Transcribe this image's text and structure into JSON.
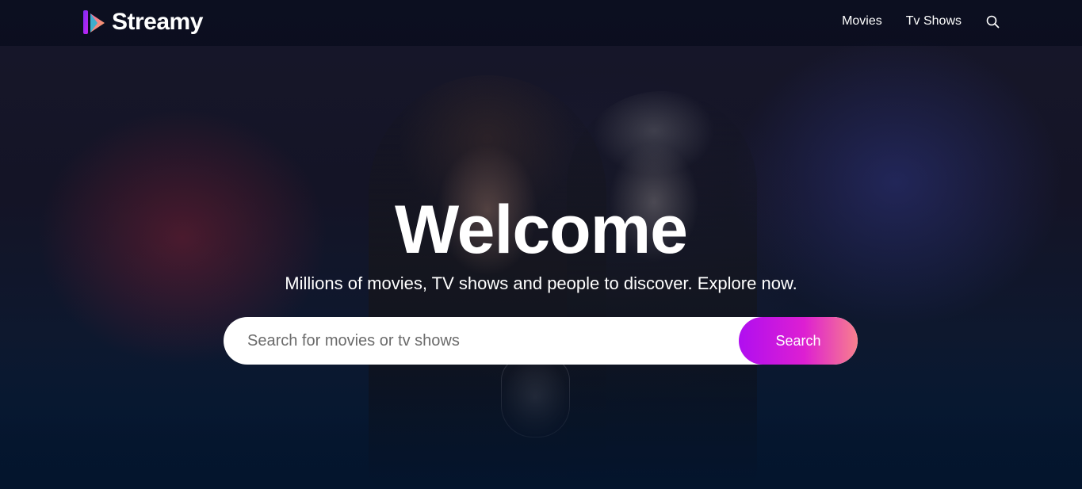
{
  "brand": {
    "name": "Streamy",
    "logo_icon": "play-stack-logo-icon",
    "gradient": [
      "#c724f0",
      "#f26da8"
    ]
  },
  "nav": {
    "items": [
      {
        "label": "Movies"
      },
      {
        "label": "Tv Shows"
      }
    ],
    "search_icon": "search-icon"
  },
  "hero": {
    "title": "Welcome",
    "subtitle": "Millions of movies, TV shows and people to discover. Explore now.",
    "search": {
      "placeholder": "Search for movies or tv shows",
      "value": "",
      "button_label": "Search",
      "button_gradient": [
        "#b00ef0",
        "#dd1fd2",
        "#f8808d"
      ]
    }
  },
  "colors": {
    "page_background": "#04152d",
    "text": "#ffffff"
  }
}
